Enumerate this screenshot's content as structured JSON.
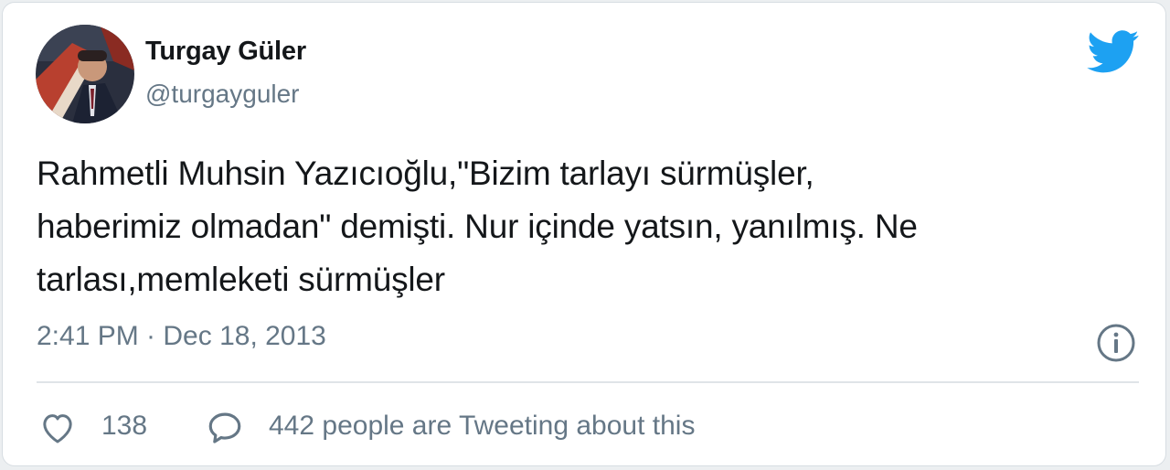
{
  "tweet": {
    "display_name": "Turgay Güler",
    "handle": "@turgayguler",
    "text": "Rahmetli Muhsin Yazıcıoğlu,\"Bizim tarlayı sürmüşler,\nhaberimiz olmadan\" demişti. Nur içinde yatsın, yanılmış. Ne\ntarlası,memleketi sürmüşler",
    "timestamp": "2:41 PM · Dec 18, 2013",
    "like_count": "138",
    "tweeting_text": "442 people are Tweeting about this"
  },
  "icons": {
    "brand": "twitter-bird-icon",
    "info": "info-icon",
    "like": "heart-icon",
    "reply": "speech-bubble-icon"
  },
  "colors": {
    "brand_blue": "#1da1f2",
    "text_primary": "#14171a",
    "text_secondary": "#657786",
    "divider": "#dfe4e8"
  }
}
